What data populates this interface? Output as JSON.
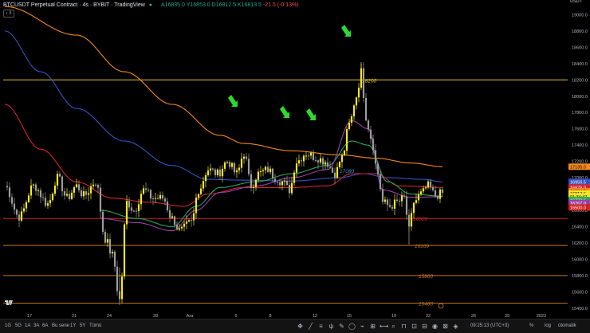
{
  "header": {
    "symbol": "BTCUSDT Perpetual Contract · 4s · BYBIT · TradingView",
    "ohlc": "A16835.0 Y16853.0 D16812.5 K16813.5",
    "change": "-21.5 (-0.13%)",
    "collapse_glyph": "›",
    "collapse_count": "3"
  },
  "currency": "USDT",
  "colors": {
    "bull": "#f5e726",
    "bear": "#9c9c9c",
    "ma_orange": "#f5891f",
    "ma_blue": "#3452c4",
    "ma_red": "#d4252a",
    "ma_green": "#26a65a",
    "ma_purple": "#9b3fa8",
    "level_yellow": "#e6c21a",
    "level_red": "#d0201e",
    "level_orange": "#c8741c",
    "arrow": "#2fd92f"
  },
  "chart_data": {
    "type": "candlestick",
    "y_range": [
      15320,
      19180
    ],
    "y_ticks": [
      "19000.0",
      "18800.0",
      "18600.0",
      "18400.0",
      "18200.0",
      "18000.0",
      "17800.0",
      "17600.0",
      "17400.0",
      "17200.0",
      "17000.0",
      "16800.0",
      "16600.0",
      "16400.0",
      "16200.0",
      "16000.0",
      "15800.0",
      "15600.0",
      "15400.0"
    ],
    "x_labels": [
      "17",
      "21",
      "24",
      "28",
      "Ara",
      "5",
      "8",
      "12",
      "15",
      "19",
      "22",
      "26",
      "29",
      "2023"
    ],
    "levels": [
      {
        "price": 18200,
        "label": "18200",
        "color": "level_yellow"
      },
      {
        "price": 16500,
        "label": "16500",
        "color": "level_red"
      },
      {
        "price": 16169,
        "label": "16169",
        "color": "level_orange"
      },
      {
        "price": 15800,
        "label": "15800",
        "color": "level_orange"
      },
      {
        "price": 15460,
        "label": "15460",
        "color": "level_orange"
      }
    ],
    "annotations": [
      {
        "text": "17080",
        "price": 17080
      }
    ],
    "price_tags": [
      {
        "text": "USDT",
        "price": 19170,
        "bg": "#000000",
        "fg": "#d1d4dc"
      },
      {
        "text": "17135.0",
        "price": 17135,
        "bg": "#f5891f",
        "fg": "#000000"
      },
      {
        "text": "16950.5",
        "price": 16950,
        "bg": "#3452c4",
        "fg": "#ffffff"
      },
      {
        "text": "16879.0",
        "price": 16880,
        "bg": "#d4252a",
        "fg": "#ffffff"
      },
      {
        "text": "16834.2",
        "price": 16834,
        "bg": "#f5891f",
        "fg": "#000000"
      },
      {
        "text": "16813.5",
        "price": 16805,
        "bg": "#f5e726",
        "fg": "#000000"
      },
      {
        "text": "01:34:47",
        "price": 16770,
        "bg": "#f5e726",
        "fg": "#000000"
      },
      {
        "text": "16773.5",
        "price": 16725,
        "bg": "#26a65a",
        "fg": "#ffffff"
      },
      {
        "text": "16767.0",
        "price": 16690,
        "bg": "#9b3fa8",
        "fg": "#ffffff"
      },
      {
        "text": "16500.0",
        "price": 16635,
        "bg": "#d0201e",
        "fg": "#ffffff"
      }
    ],
    "anchors": [
      [
        0,
        16900
      ],
      [
        6,
        16520
      ],
      [
        12,
        16900
      ],
      [
        18,
        16680
      ],
      [
        22,
        17000
      ],
      [
        26,
        16750
      ],
      [
        30,
        16900
      ],
      [
        33,
        16780
      ],
      [
        38,
        16950
      ],
      [
        42,
        16250
      ],
      [
        45,
        16050
      ],
      [
        48,
        15500
      ],
      [
        51,
        16700
      ],
      [
        54,
        16600
      ],
      [
        58,
        16850
      ],
      [
        62,
        16750
      ],
      [
        66,
        16750
      ],
      [
        70,
        16500
      ],
      [
        73,
        16350
      ],
      [
        78,
        16450
      ],
      [
        81,
        16850
      ],
      [
        85,
        17100
      ],
      [
        89,
        17050
      ],
      [
        93,
        17200
      ],
      [
        97,
        17050
      ],
      [
        100,
        17300
      ],
      [
        103,
        16900
      ],
      [
        106,
        17050
      ],
      [
        110,
        17100
      ],
      [
        113,
        17000
      ],
      [
        116,
        16950
      ],
      [
        119,
        16850
      ],
      [
        122,
        17200
      ],
      [
        126,
        17300
      ],
      [
        130,
        17250
      ],
      [
        134,
        17200
      ],
      [
        138,
        17050
      ],
      [
        141,
        17250
      ],
      [
        144,
        17650
      ],
      [
        147,
        18000
      ],
      [
        149,
        18300
      ],
      [
        151,
        17750
      ],
      [
        153,
        17500
      ],
      [
        156,
        17050
      ],
      [
        158,
        16700
      ],
      [
        161,
        16650
      ],
      [
        164,
        16700
      ],
      [
        167,
        16750
      ],
      [
        169,
        16350
      ],
      [
        171,
        16700
      ],
      [
        174,
        16800
      ],
      [
        177,
        16900
      ],
      [
        180,
        16780
      ],
      [
        183,
        16813
      ]
    ],
    "ma": [
      {
        "name": "ma_orange",
        "pts": [
          [
            0,
            19100
          ],
          [
            30,
            18750
          ],
          [
            50,
            18300
          ],
          [
            70,
            17900
          ],
          [
            90,
            17520
          ],
          [
            100,
            17420
          ],
          [
            120,
            17330
          ],
          [
            140,
            17280
          ],
          [
            155,
            17240
          ],
          [
            170,
            17180
          ],
          [
            183,
            17135
          ]
        ]
      },
      {
        "name": "ma_blue",
        "pts": [
          [
            0,
            18800
          ],
          [
            15,
            18300
          ],
          [
            30,
            17850
          ],
          [
            50,
            17450
          ],
          [
            70,
            17150
          ],
          [
            85,
            16980
          ],
          [
            100,
            16970
          ],
          [
            120,
            16960
          ],
          [
            140,
            17000
          ],
          [
            150,
            17050
          ],
          [
            160,
            17000
          ],
          [
            175,
            16980
          ],
          [
            183,
            16950
          ]
        ]
      },
      {
        "name": "ma_red",
        "pts": [
          [
            0,
            17900
          ],
          [
            15,
            17350
          ],
          [
            30,
            16950
          ],
          [
            45,
            16750
          ],
          [
            60,
            16700
          ],
          [
            75,
            16650
          ],
          [
            85,
            16800
          ],
          [
            100,
            16880
          ],
          [
            120,
            16880
          ],
          [
            135,
            16900
          ],
          [
            145,
            17050
          ],
          [
            155,
            17050
          ],
          [
            165,
            16900
          ],
          [
            183,
            16880
          ]
        ]
      },
      {
        "name": "ma_green",
        "pts": [
          [
            40,
            16600
          ],
          [
            55,
            16500
          ],
          [
            70,
            16400
          ],
          [
            80,
            16650
          ],
          [
            90,
            16880
          ],
          [
            105,
            16950
          ],
          [
            120,
            17050
          ],
          [
            135,
            17150
          ],
          [
            145,
            17450
          ],
          [
            152,
            17400
          ],
          [
            160,
            16950
          ],
          [
            170,
            16800
          ],
          [
            183,
            16773
          ]
        ]
      },
      {
        "name": "ma_purple",
        "pts": [
          [
            40,
            16500
          ],
          [
            55,
            16450
          ],
          [
            70,
            16350
          ],
          [
            80,
            16600
          ],
          [
            90,
            16820
          ],
          [
            105,
            16900
          ],
          [
            120,
            17000
          ],
          [
            135,
            17100
          ],
          [
            145,
            17700
          ],
          [
            152,
            17600
          ],
          [
            158,
            16850
          ],
          [
            170,
            16760
          ],
          [
            183,
            16767
          ]
        ]
      }
    ]
  },
  "bottom": {
    "timeframes": [
      "1G",
      "5G",
      "1A",
      "3A",
      "6A",
      "Bu sene",
      "1Y",
      "5Y",
      "Tümü"
    ],
    "clock": "09:25:13 (UTC+3)",
    "pct": "%",
    "log": "log",
    "auto": "otomatik"
  }
}
